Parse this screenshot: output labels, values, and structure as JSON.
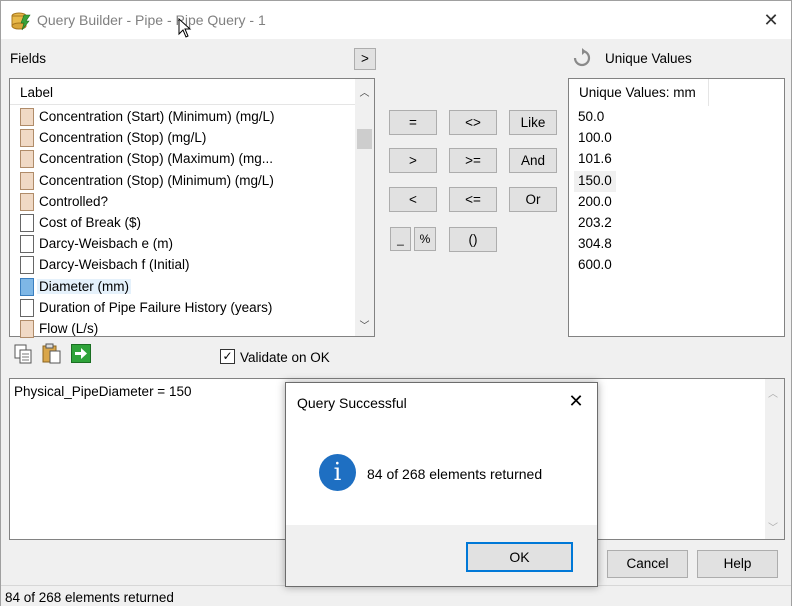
{
  "window": {
    "title": "Query Builder - Pipe - Pipe Query - 1"
  },
  "fields": {
    "label": "Fields",
    "expand_button": ">",
    "column_header": "Label",
    "items": [
      {
        "label": "Concentration (Start) (Minimum) (mg/L)",
        "icon": "tan"
      },
      {
        "label": "Concentration (Stop) (mg/L)",
        "icon": "tan"
      },
      {
        "label": "Concentration (Stop) (Maximum) (mg...",
        "icon": "tan"
      },
      {
        "label": "Concentration (Stop) (Minimum) (mg/L)",
        "icon": "tan"
      },
      {
        "label": "Controlled?",
        "icon": "tan"
      },
      {
        "label": "Cost of Break ($)",
        "icon": "white"
      },
      {
        "label": "Darcy-Weisbach e (m)",
        "icon": "white"
      },
      {
        "label": "Darcy-Weisbach f (Initial)",
        "icon": "white"
      },
      {
        "label": "Diameter (mm)",
        "icon": "blue",
        "selected": true
      },
      {
        "label": "Duration of Pipe Failure History (years)",
        "icon": "white"
      },
      {
        "label": "Flow (L/s)",
        "icon": "tan"
      }
    ]
  },
  "operators": {
    "eq": "=",
    "neq": "<>",
    "like": "Like",
    "gt": ">",
    "gte": ">=",
    "and": "And",
    "lt": "<",
    "lte": "<=",
    "or": "Or",
    "underscore": "_",
    "percent": "%",
    "parens": "()"
  },
  "unique_values": {
    "label": "Unique Values",
    "column_header": "Unique Values: mm",
    "items": [
      "50.0",
      "100.0",
      "101.6",
      "150.0",
      "200.0",
      "203.2",
      "304.8",
      "600.0"
    ],
    "selected_index": 3
  },
  "validate": {
    "label": "Validate on OK",
    "checked": true
  },
  "query": {
    "text": "Physical_PipeDiameter = 150"
  },
  "buttons": {
    "cancel": "Cancel",
    "help": "Help"
  },
  "status": {
    "text": "84 of 268 elements returned"
  },
  "dialog": {
    "title": "Query Successful",
    "message": "84 of 268 elements returned",
    "ok": "OK"
  },
  "colors": {
    "accent": "#0078d7",
    "info_icon": "#1e6fc2",
    "selection": "#e5f1fb"
  }
}
